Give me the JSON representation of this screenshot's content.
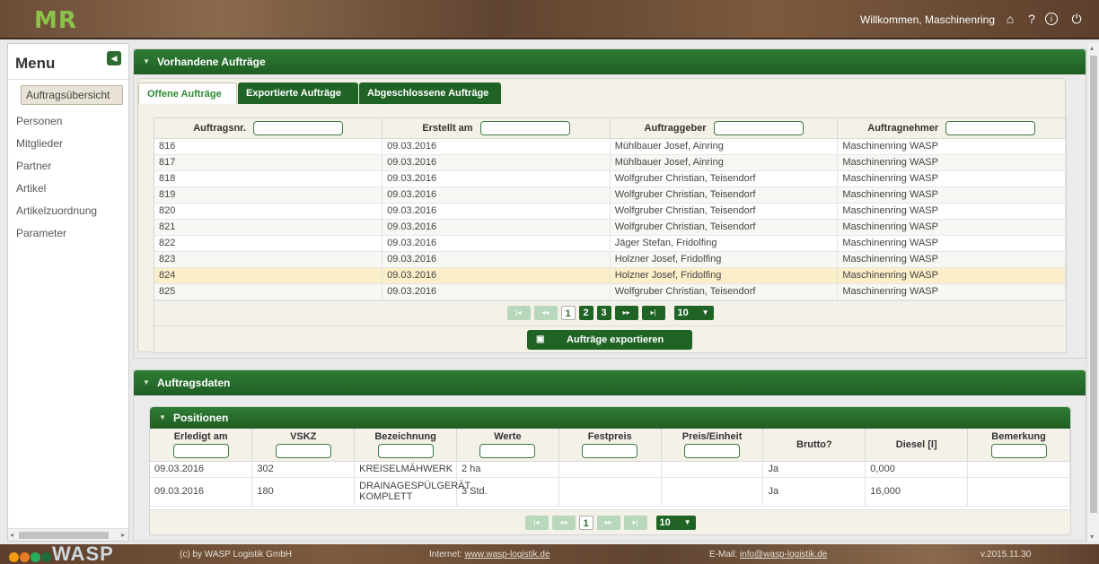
{
  "header": {
    "logo_text": "MR",
    "welcome": "Willkommen, Maschinenring",
    "icons": [
      "home-icon",
      "help-icon",
      "info-icon",
      "logout-icon"
    ]
  },
  "sidebar": {
    "title": "Menu",
    "items": [
      {
        "label": "Auftragsübersicht",
        "active": true
      },
      {
        "label": "Personen"
      },
      {
        "label": "Mitglieder"
      },
      {
        "label": "Partner"
      },
      {
        "label": "Artikel"
      },
      {
        "label": "Artikelzuordnung"
      },
      {
        "label": "Parameter"
      }
    ]
  },
  "panel1": {
    "title": "Vorhandene Aufträge",
    "tabs": [
      "Offene Aufträge",
      "Exportierte Aufträge",
      "Abgeschlossene Aufträge"
    ],
    "columns": [
      "Auftragsnr.",
      "Erstellt am",
      "Auftraggeber",
      "Auftragnehmer"
    ],
    "rows": [
      [
        "816",
        "09.03.2016",
        "Mühlbauer Josef, Ainring",
        "Maschinenring WASP"
      ],
      [
        "817",
        "09.03.2016",
        "Mühlbauer Josef, Ainring",
        "Maschinenring WASP"
      ],
      [
        "818",
        "09.03.2016",
        "Wolfgruber Christian, Teisendorf",
        "Maschinenring WASP"
      ],
      [
        "819",
        "09.03.2016",
        "Wolfgruber Christian, Teisendorf",
        "Maschinenring WASP"
      ],
      [
        "820",
        "09.03.2016",
        "Wolfgruber Christian, Teisendorf",
        "Maschinenring WASP"
      ],
      [
        "821",
        "09.03.2016",
        "Wolfgruber Christian, Teisendorf",
        "Maschinenring WASP"
      ],
      [
        "822",
        "09.03.2016",
        "Jäger Stefan, Fridolfing",
        "Maschinenring WASP"
      ],
      [
        "823",
        "09.03.2016",
        "Holzner Josef, Fridolfing",
        "Maschinenring WASP"
      ],
      [
        "824",
        "09.03.2016",
        "Holzner Josef, Fridolfing",
        "Maschinenring WASP"
      ],
      [
        "825",
        "09.03.2016",
        "Wolfgruber Christian, Teisendorf",
        "Maschinenring WASP"
      ]
    ],
    "selected_row": 8,
    "pager": {
      "pages": [
        "1",
        "2",
        "3"
      ],
      "current": "1",
      "page_size": "10"
    },
    "export_label": "Aufträge exportieren"
  },
  "panel2": {
    "title": "Auftragsdaten",
    "sub_title": "Positionen",
    "columns": [
      "Erledigt am",
      "VSKZ",
      "Bezeichnung",
      "Werte",
      "Festpreis",
      "Preis/Einheit",
      "Brutto?",
      "Diesel [l]",
      "Bemerkung"
    ],
    "rows": [
      [
        "09.03.2016",
        "302",
        "KREISELMÄHWERK",
        "2 ha",
        "",
        "",
        "Ja",
        "0,000",
        ""
      ],
      [
        "09.03.2016",
        "180",
        "DRAINAGESPÜLGERÄT KOMPLETT",
        "3 Std.",
        "",
        "",
        "Ja",
        "16,000",
        ""
      ]
    ],
    "pager": {
      "pages": [
        "1"
      ],
      "current": "1",
      "page_size": "10"
    }
  },
  "footer": {
    "logo": "WASP",
    "copyright": "(c) by WASP Logistik GmbH",
    "internet_label": "Internet: ",
    "internet_link": "www.wasp-logistik.de",
    "email_label": "E-Mail: ",
    "email_link": "info@wasp-logistik.de",
    "version": "v.2015.11.30"
  },
  "colors": {
    "primary_green": "#1f6425",
    "accent_green": "#2e8b34",
    "selected_row": "#fbefc9",
    "wood": "#6b4c35"
  }
}
